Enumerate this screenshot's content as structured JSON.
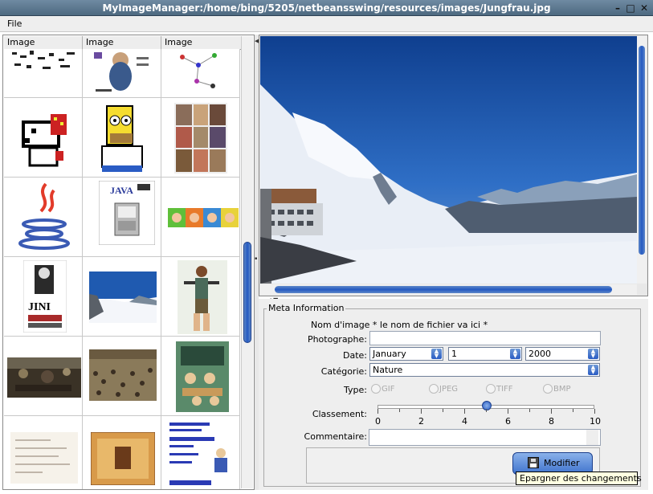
{
  "window": {
    "title": "MyImageManager:/home/bing/5205/netbeansswing/resources/images/Jungfrau.jpg",
    "buttons": [
      "minimize-icon",
      "maximize-icon",
      "close-icon"
    ]
  },
  "menubar": {
    "items": [
      "File"
    ]
  },
  "table": {
    "columns": [
      "Image",
      "Image",
      "Image"
    ],
    "scroll_position": 0.42
  },
  "viewer": {
    "image": "Jungfrau.jpg",
    "colors": {
      "sky": "#1d56a8",
      "snow": "#f4f6fa",
      "rock": "#5a5f66"
    }
  },
  "meta": {
    "legend": "Meta Information",
    "name_label": "Nom d'image * le nom de fichier va ici *",
    "photographer_label": "Photographe:",
    "photographer_value": "",
    "date_label": "Date:",
    "month": "January",
    "day": "1",
    "year": "2000",
    "category_label": "Catégorie:",
    "category": "Nature",
    "type_label": "Type:",
    "types": [
      "GIF",
      "JPEG",
      "TIFF",
      "BMP"
    ],
    "rating_label": "Classement:",
    "rating_ticks": [
      "0",
      "2",
      "4",
      "6",
      "8",
      "10"
    ],
    "rating_value": 5,
    "comment_label": "Commentaire:",
    "comment_value": "",
    "modify_button": "Modifier",
    "tooltip": "Epargner des changements",
    "accent_color": "#2a5cc4"
  }
}
